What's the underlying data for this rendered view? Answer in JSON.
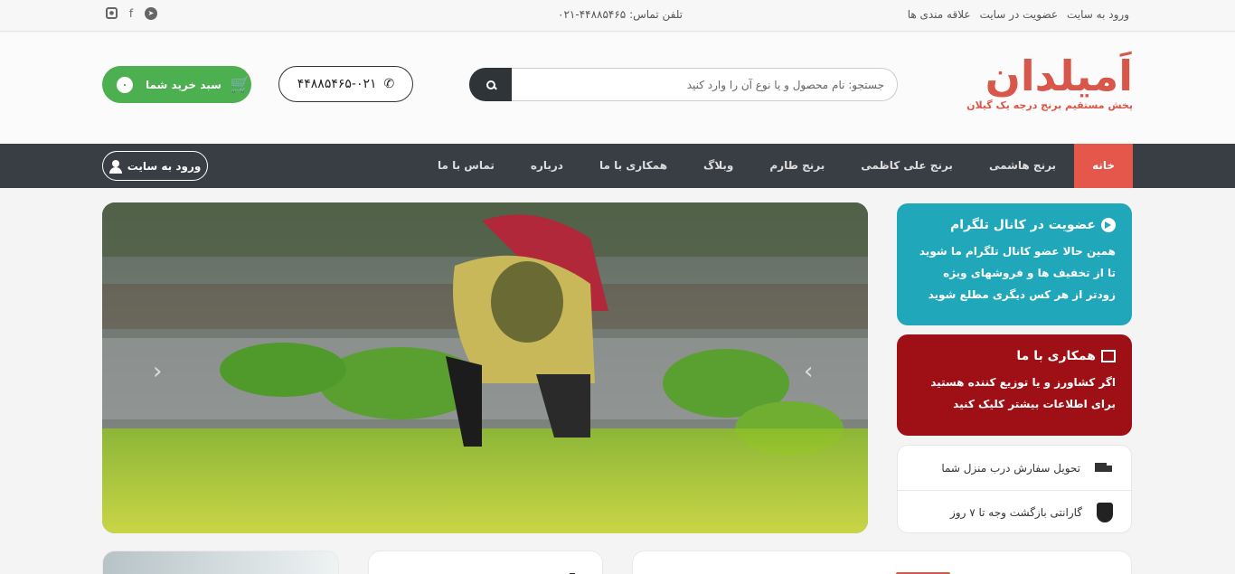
{
  "topbar": {
    "links": [
      "ورود به سایت",
      "عضویت در سایت",
      "علاقه مندی ها"
    ],
    "phone_label": "تلفن تماس: ۴۴۸۸۵۴۶۵-۰۲۱",
    "social_icons": [
      "telegram-icon",
      "facebook-icon",
      "instagram-icon"
    ]
  },
  "header": {
    "logo_name": "اَمیلدان",
    "logo_tagline": "پخش مستقیم برنج درجه یک گیلان",
    "search_placeholder": "جستجو: نام محصول و یا نوع آن را وارد کنید",
    "phone": "۴۴۸۸۵۴۶۵-۰۲۱",
    "cart_label": "سبد خرید شما",
    "cart_count": "۰"
  },
  "nav": {
    "items": [
      "خانه",
      "برنج هاشمی",
      "برنج علی کاظمی",
      "برنج طارم",
      "وبلاگ",
      "همکاری با ما",
      "درباره",
      "تماس با ما"
    ],
    "active_index": 0,
    "login_label": "ورود به سایت"
  },
  "sidebar": {
    "telegram_card": {
      "title": "عضویت در کانال تلگرام",
      "text": "همین حالا عضو کانال تلگرام ما شوید تا از تخفیف ها و فروشهای ویژه زودتر از هر کس دیگری مطلع شوید"
    },
    "coop_card": {
      "title": "همکاری با ما",
      "text": "اگر کشاورز و یا توزیع کننده هستید برای اطلاعات بیشتر کلیک کنید"
    },
    "features": [
      {
        "icon": "truck-icon",
        "label": "تحویل سفارش درب منزل شما"
      },
      {
        "icon": "shield-icon",
        "label": "گارانتی بازگشت وجه تا ۷ روز"
      }
    ]
  },
  "colors": {
    "brand_red": "#d9574a",
    "nav_bg": "#393d44",
    "cart_green": "#4caf50",
    "telegram_teal": "#20a7ba",
    "coop_maroon": "#9e1015"
  }
}
